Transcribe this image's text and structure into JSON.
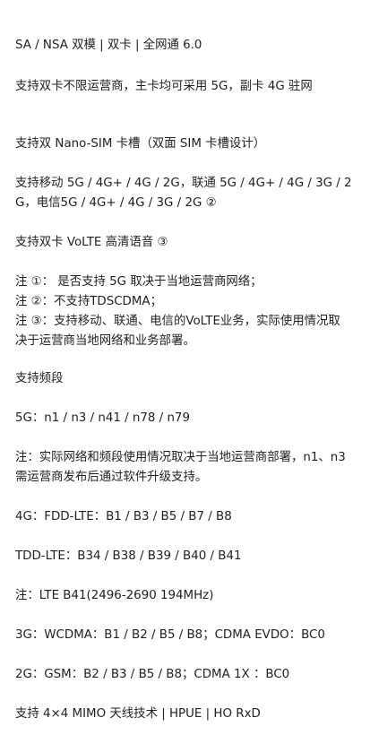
{
  "spec": {
    "network_mode": "SA / NSA 双模 | 双卡 | 全网通 6.0",
    "dual_card_line": "支持双卡不限运营商，主卡均可采用 5G，副卡 4G 驻网",
    "sim_slot": "支持双 Nano-SIM 卡槽（双面 SIM 卡槽设计）",
    "carriers": "支持移动 5G / 4G+ / 4G / 2G，联通 5G / 4G+ / 4G / 3G / 2G，电信5G / 4G+ / 4G / 3G / 2G ②",
    "volte": "支持双卡 VoLTE 高清语音 ③",
    "notes": {
      "note1": "注 ①： 是否支持 5G 取决于当地运营商网络；",
      "note2": "注 ②：不支持TDSCDMA；",
      "note3": "注 ③：支持移动、联通、电信的VoLTE业务，实际使用情况取决于运营商当地网络和业务部署。"
    },
    "bands_title": "支持频段",
    "band_5g": "5G：n1 / n3 / n41 / n78 / n79",
    "band_note": "注：实际网络和频段使用情况取决于当地运营商部署，n1、n3 需运营商发布后通过软件升级支持。",
    "band_4g_fdd": "4G：FDD-LTE：B1 / B3 / B5 / B7 / B8",
    "band_tdd": "TDD-LTE：B34 / B38 / B39 / B40 / B41",
    "band_note_lte": "注：LTE B41(2496-2690 194MHz)",
    "band_3g": "3G：WCDMA：B1 / B2 / B5 / B8；CDMA EVDO：BC0",
    "band_2g": "2G：GSM：B2 / B3 / B5 / B8；CDMA 1X ：BC0",
    "mimo": "支持 4×4 MIMO 天线技术 | HPUE | HO RxD"
  }
}
